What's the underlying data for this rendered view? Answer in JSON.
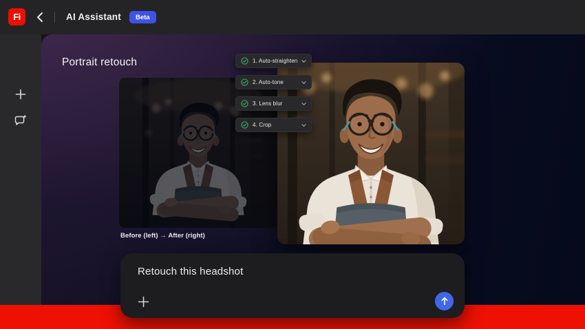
{
  "topbar": {
    "logo_text": "Fi",
    "title": "AI Assistant",
    "badge": "Beta"
  },
  "sidebar": {
    "icons": [
      "plus-icon",
      "chat-sparkle-icon"
    ]
  },
  "main": {
    "heading": "Portrait retouch",
    "steps": [
      {
        "label": "1. Auto-straighten",
        "status": "done"
      },
      {
        "label": "2. Auto-tone",
        "status": "done"
      },
      {
        "label": "3. Lens blur",
        "status": "done"
      },
      {
        "label": "4. Crop",
        "status": "done"
      }
    ],
    "caption": "Before (left) → After (right)",
    "composer": {
      "text": "Retouch this headshot"
    }
  },
  "colors": {
    "brand_red": "#eb1000",
    "bottom_band_red": "#ee1102",
    "badge_blue": "#3e53e6",
    "send_blue": "#4166e8",
    "check_green": "#3aa35e",
    "panel_purple": "#452b52",
    "panel_navy": "#070b1e"
  }
}
